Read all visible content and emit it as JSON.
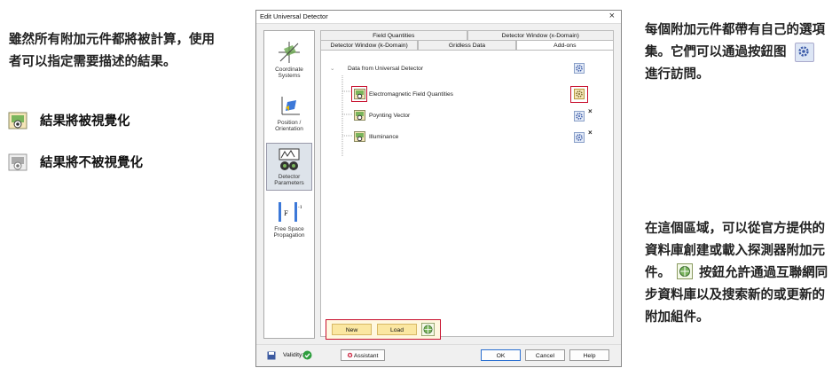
{
  "annotations": {
    "left_intro": "雖然所有附加元件都將被計算，使用者可以指定需要描述的結果。",
    "legend_visualized": "結果將被視覺化",
    "legend_not_visualized": "結果將不被視覺化",
    "right_top_part1": "每個附加元件都帶有自己的選項集。它們可以通過按鈕图",
    "right_top_part2": "進行訪問。",
    "right_bottom_part1": "在這個區域，可以從官方提供的資料庫創建或載入探測器附加元件。",
    "right_bottom_part2": "按鈕允許通過互聯網同步資料庫以及搜索新的或更新的附加組件。"
  },
  "dialog": {
    "title": "Edit Universal Detector",
    "close": "×",
    "sidebar": [
      {
        "label": "Coordinate Systems",
        "icon": "coordinate-systems-icon"
      },
      {
        "label": "Position / Orientation",
        "icon": "position-orientation-icon"
      },
      {
        "label": "Detector Parameters",
        "icon": "detector-parameters-icon"
      },
      {
        "label": "Free Space Propagation",
        "icon": "free-space-propagation-icon"
      }
    ],
    "tabs_row1": [
      "Field Quantities",
      "Detector Window (x-Domain)"
    ],
    "tabs_row2": [
      "Detector Window (k-Domain)",
      "Gridless Data",
      "Add-ons"
    ],
    "active_tab": "Add-ons",
    "tree": {
      "root": "Data from Universal Detector",
      "items": [
        "Electromagnetic Field Quantities",
        "Poynting Vector",
        "Illuminance"
      ]
    },
    "bottom_buttons": {
      "new": "New",
      "load": "Load"
    },
    "footer": {
      "validity_label": "Validity:",
      "assistant": "Assistant",
      "ok": "OK",
      "cancel": "Cancel",
      "help": "Help"
    }
  },
  "colors": {
    "highlight_red": "#c8102e",
    "accent_blue": "#2a6fd0",
    "button_yellow": "#fbe7a1"
  }
}
